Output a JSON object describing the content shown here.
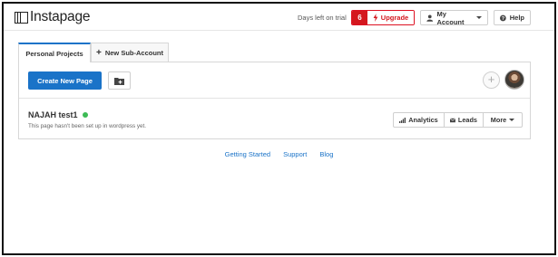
{
  "app": {
    "logo_text": "Instapage"
  },
  "header": {
    "trial_label": "Days left on trial",
    "days_left": "6",
    "upgrade_label": "Upgrade",
    "account_label": "My Account",
    "help_label": "Help"
  },
  "tabs": [
    {
      "label": "Personal Projects",
      "active": true
    },
    {
      "label": "New Sub-Account",
      "active": false
    }
  ],
  "toolbar": {
    "create_label": "Create New Page"
  },
  "page": {
    "name": "NAJAH test1",
    "status_color": "#3dbb55",
    "description": "This page hasn't been set up in wordpress yet.",
    "actions": {
      "analytics": "Analytics",
      "leads": "Leads",
      "more": "More"
    }
  },
  "footer": {
    "links": [
      "Getting Started",
      "Support",
      "Blog"
    ]
  },
  "colors": {
    "accent": "#1a73c8",
    "upgrade": "#d4171e"
  }
}
